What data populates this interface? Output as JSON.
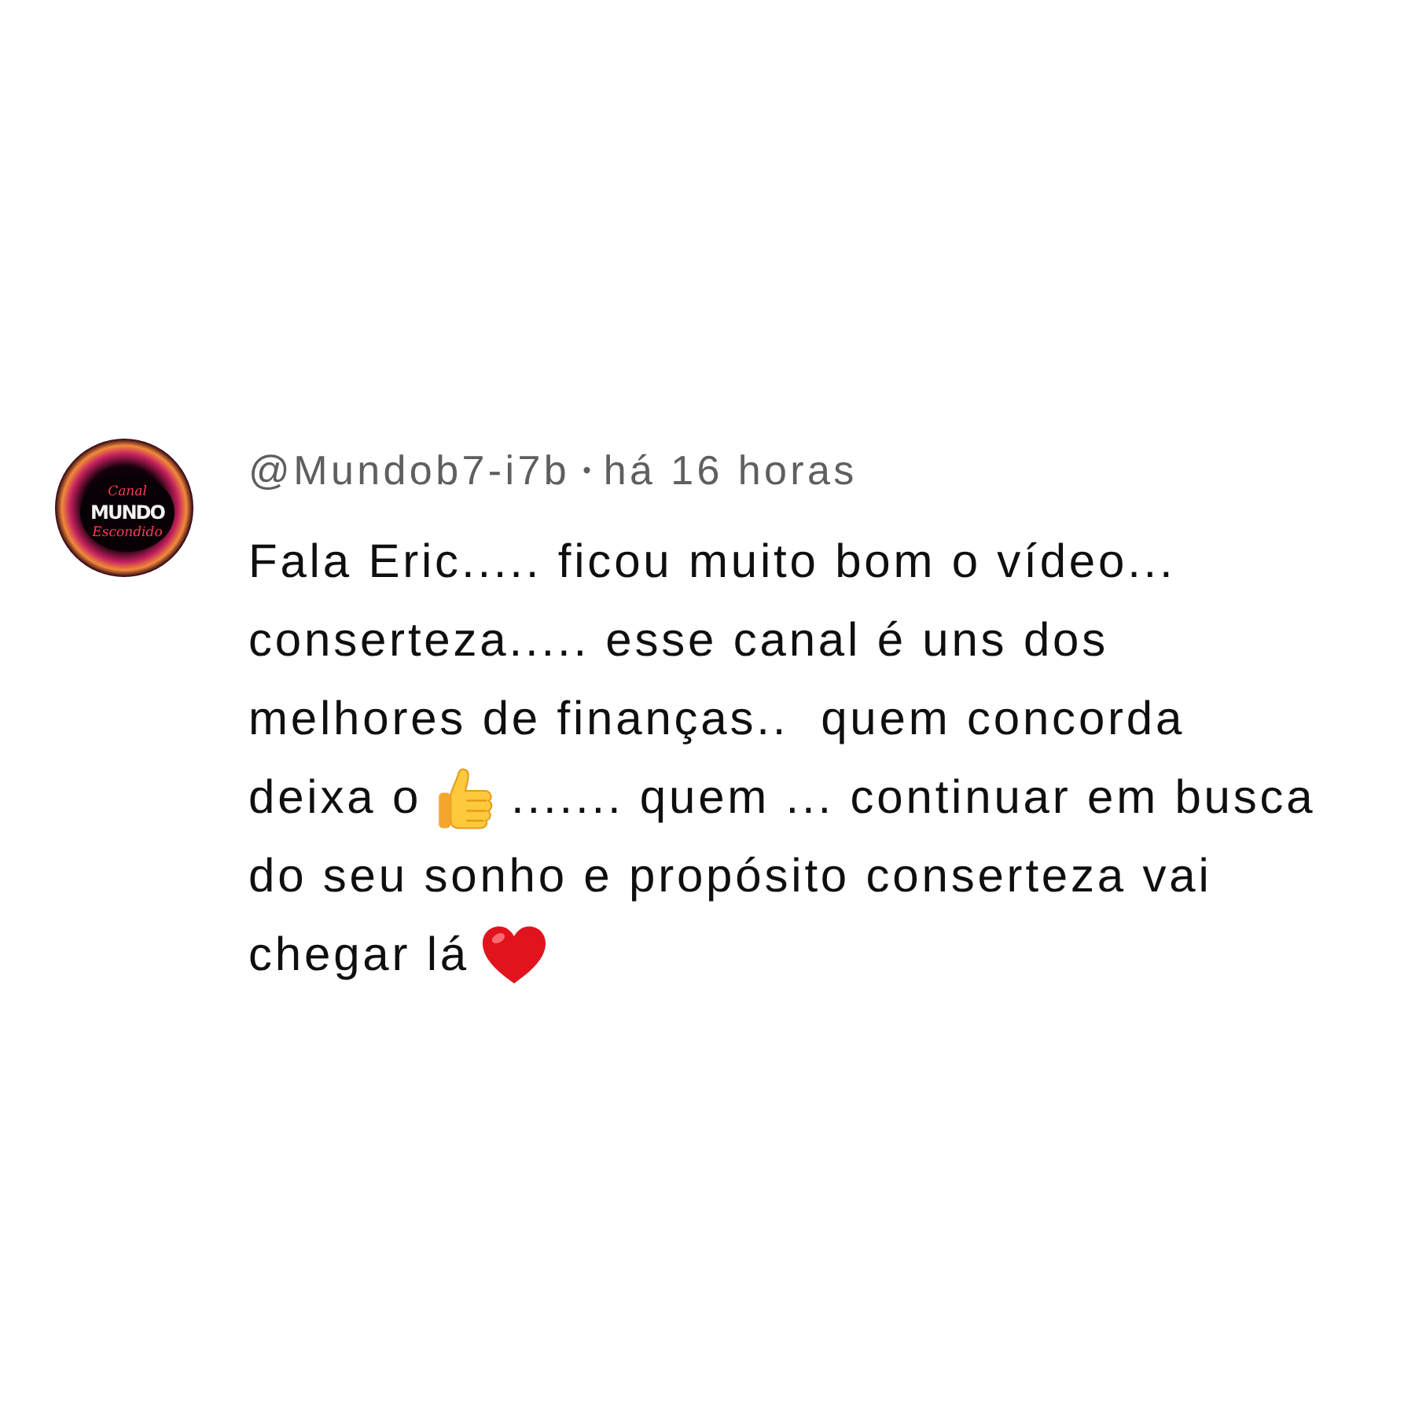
{
  "comment": {
    "avatar": {
      "logo_lines": [
        {
          "kind": "script",
          "text": "Canal"
        },
        {
          "kind": "block",
          "text": "MUNDO"
        },
        {
          "kind": "script",
          "text": "Escondido"
        }
      ]
    },
    "author": "@Mundob7-i7b",
    "separator": "•",
    "time": "há 16 horas",
    "body_lines": [
      [
        {
          "kind": "text",
          "text": "Fala Eric..... ficou muito bom o vídeo..."
        }
      ],
      [
        {
          "kind": "text",
          "text": "conserteza..... esse canal é uns dos"
        }
      ],
      [
        {
          "kind": "text",
          "text": "melhores de finanças..  quem concorda"
        }
      ],
      [
        {
          "kind": "text",
          "text": "deixa o"
        },
        {
          "kind": "thumbs_up"
        },
        {
          "kind": "text",
          "text": "....... quem ... continuar em busca"
        }
      ],
      [
        {
          "kind": "text",
          "text": "do seu sonho e propósito conserteza vai"
        }
      ],
      [
        {
          "kind": "text",
          "text": "chegar lá"
        },
        {
          "kind": "heart"
        }
      ]
    ]
  }
}
